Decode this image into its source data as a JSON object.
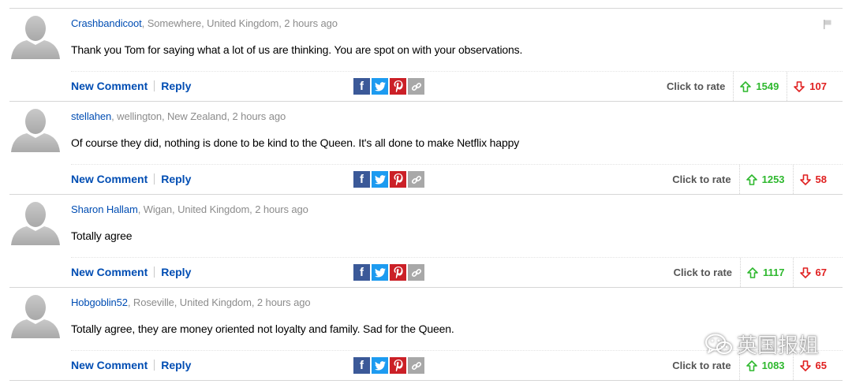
{
  "actions": {
    "new_comment_label": "New Comment",
    "reply_label": "Reply",
    "click_to_rate_label": "Click to rate"
  },
  "share_icons": [
    "facebook-icon",
    "twitter-icon",
    "pinterest-icon",
    "link-icon"
  ],
  "colors": {
    "link_blue": "#004db3",
    "meta_grey": "#8c8c8c",
    "upvote_green": "#2eb82e",
    "downvote_red": "#e02020",
    "facebook": "#3b5998",
    "twitter": "#1d9bf0",
    "pinterest": "#cb2027"
  },
  "comments": [
    {
      "username": "Crashbandicoot",
      "location": ", Somewhere, United Kingdom, 2 hours ago",
      "text": "Thank you Tom for saying what a lot of us are thinking. You are spot on with your observations.",
      "upvotes": "1549",
      "downvotes": "107"
    },
    {
      "username": "stellahen",
      "location": ", wellington, New Zealand, 2 hours ago",
      "text": "Of course they did, nothing is done to be kind to the Queen. It's all done to make Netflix happy",
      "upvotes": "1253",
      "downvotes": "58"
    },
    {
      "username": "Sharon Hallam",
      "location": ", Wigan, United Kingdom, 2 hours ago",
      "text": "Totally agree",
      "upvotes": "1117",
      "downvotes": "67"
    },
    {
      "username": "Hobgoblin52",
      "location": ", Roseville, United Kingdom, 2 hours ago",
      "text": "Totally agree, they are money oriented not loyalty and family. Sad for the Queen.",
      "upvotes": "1083",
      "downvotes": "65"
    }
  ],
  "watermark": {
    "text": "英国报姐"
  }
}
